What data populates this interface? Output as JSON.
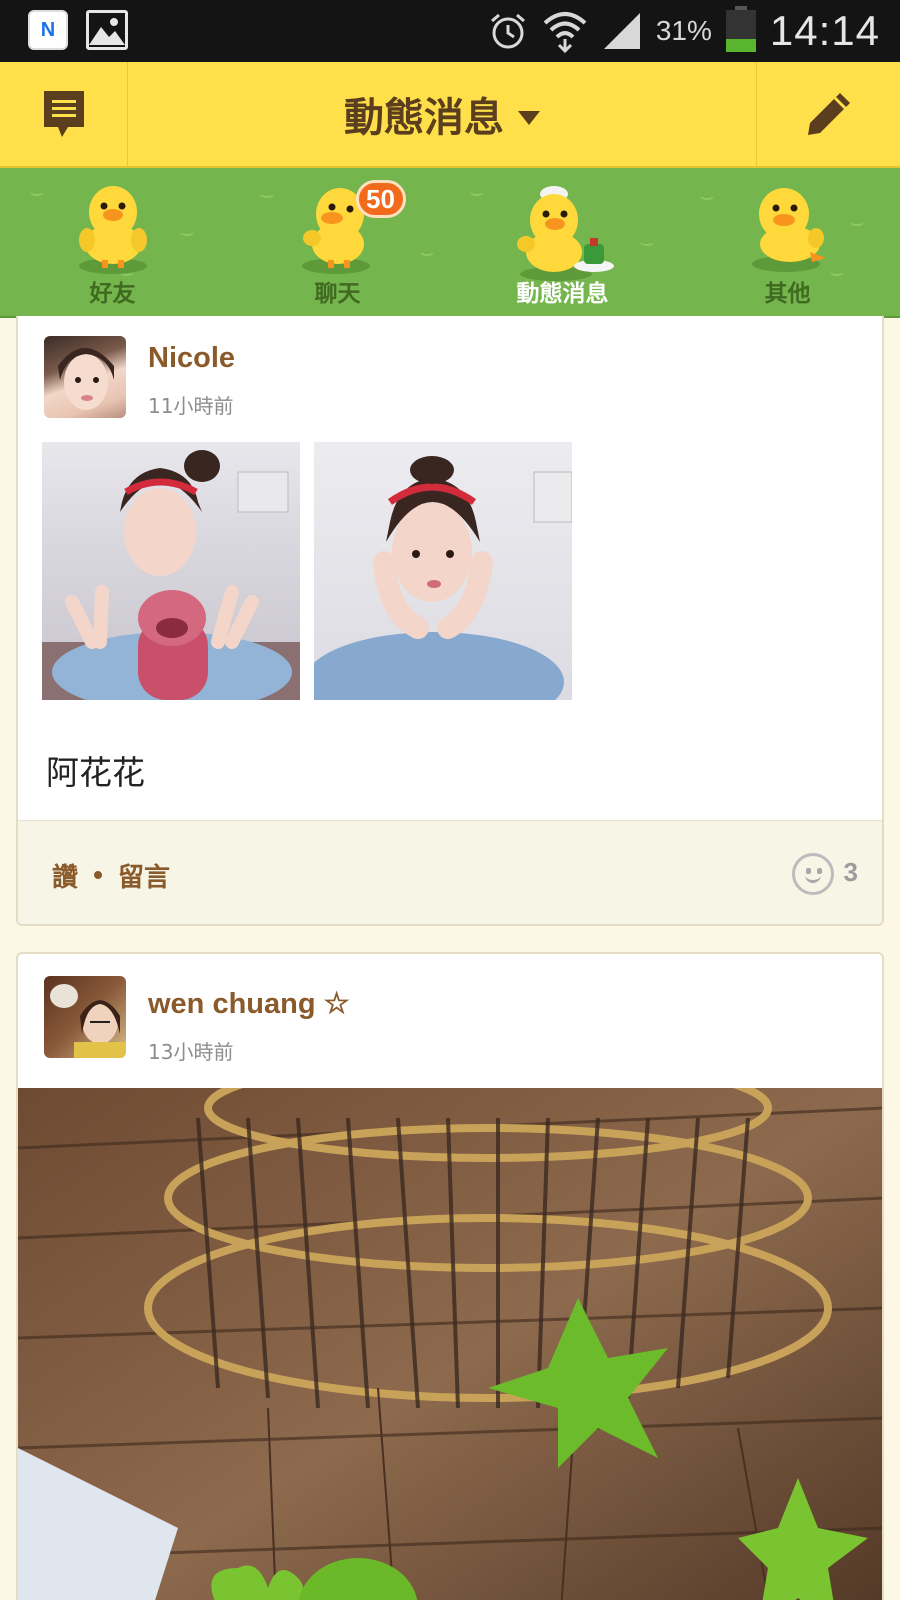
{
  "status_bar": {
    "notification_app_letter": "N",
    "battery_percent": "31%",
    "battery_level": 0.31,
    "time": "14:14",
    "icons": [
      "n-app-icon",
      "gallery-icon",
      "alarm-icon",
      "wifi-icon",
      "signal-icon",
      "battery-icon"
    ]
  },
  "header": {
    "title": "動態消息",
    "left_icon": "memo-icon",
    "right_icon": "pencil-icon"
  },
  "tabs": [
    {
      "label": "好友",
      "active": false
    },
    {
      "label": "聊天",
      "active": false,
      "badge": "50"
    },
    {
      "label": "動態消息",
      "active": true
    },
    {
      "label": "其他",
      "active": false
    }
  ],
  "posts": [
    {
      "author": "Nicole",
      "time": "11小時前",
      "text": "阿花花",
      "footer": {
        "like": "讚",
        "comment": "留言",
        "reaction_count": "3"
      }
    },
    {
      "author": "wen chuang ☆",
      "time": "13小時前"
    }
  ],
  "colors": {
    "header_bg": "#ffe04a",
    "tabs_bg": "#75b54d",
    "accent_brown": "#8b5a2b",
    "badge": "#f26a1b"
  }
}
